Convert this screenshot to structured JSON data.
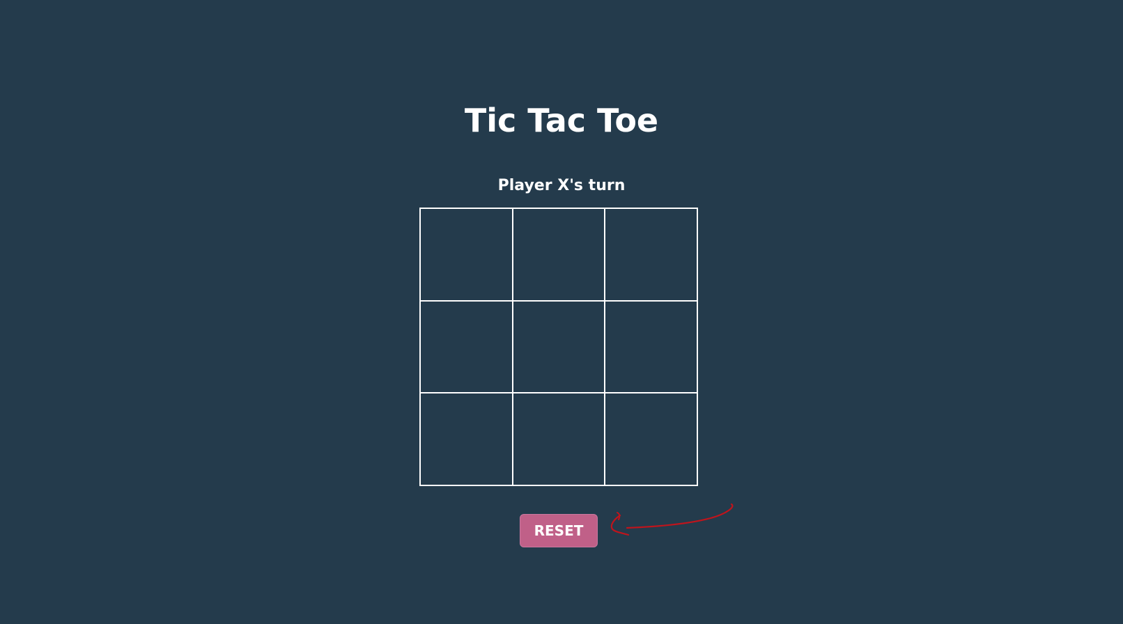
{
  "title": "Tic Tac Toe",
  "status": "Player X's turn",
  "board": {
    "cells": [
      "",
      "",
      "",
      "",
      "",
      "",
      "",
      "",
      ""
    ]
  },
  "controls": {
    "reset_label": "RESET"
  },
  "colors": {
    "background": "#243b4c",
    "text": "#ffffff",
    "grid_lines": "#ffffff",
    "reset_button": "#c06088",
    "annotation_arrow": "#c0141c"
  },
  "icons": {
    "annotation": "red-hand-drawn-arrow-icon"
  }
}
